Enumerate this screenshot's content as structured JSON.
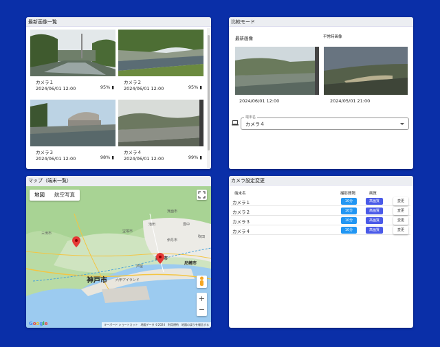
{
  "latest": {
    "title": "最新画像一覧",
    "cameras": [
      {
        "name": "カメラ１",
        "time": "2024/06/01 12:00",
        "battery": "95%"
      },
      {
        "name": "カメラ２",
        "time": "2024/06/01 12:00",
        "battery": "95%"
      },
      {
        "name": "カメラ３",
        "time": "2024/06/01 12:00",
        "battery": "98%"
      },
      {
        "name": "カメラ４",
        "time": "2024/06/01 12:00",
        "battery": "99%"
      }
    ]
  },
  "compare": {
    "title": "比較モード",
    "left_label": "最新画像",
    "right_label": "平常時画像",
    "left_date": "2024/06/01 12:00",
    "right_date": "2024/05/01 21:00",
    "select_legend": "端末名",
    "select_value": "カメラ４"
  },
  "map": {
    "title": "マップ（端末一覧）",
    "tab_map": "地図",
    "tab_satellite": "航空写真",
    "footer": "キーボード ショートカット　地図データ ©2024　利用規約　地図の誤りを報告する",
    "google": "Google",
    "labels": {
      "kobe": "神戸市",
      "nishinomiya": "西宮市",
      "amagasaki": "尼崎市",
      "rokko": "六甲アイランド",
      "minoh": "箕面市",
      "itami": "伊丹市",
      "ikeda": "池田",
      "toyonaka": "豊中",
      "suita": "吹田",
      "sanda": "三田市",
      "takarazuka": "宝塚市",
      "ashiya": "芦屋"
    }
  },
  "settings": {
    "title": "カメラ設定変更",
    "col_name": "端末名",
    "col_interval": "撮影間隔",
    "col_quality": "画質",
    "rows": [
      {
        "name": "カメラ１",
        "interval": "10分",
        "quality": "高画質",
        "change": "変更"
      },
      {
        "name": "カメラ２",
        "interval": "10分",
        "quality": "高画質",
        "change": "変更"
      },
      {
        "name": "カメラ３",
        "interval": "10分",
        "quality": "高画質",
        "change": "変更"
      },
      {
        "name": "カメラ４",
        "interval": "10分",
        "quality": "高画質",
        "change": "変更"
      }
    ]
  }
}
